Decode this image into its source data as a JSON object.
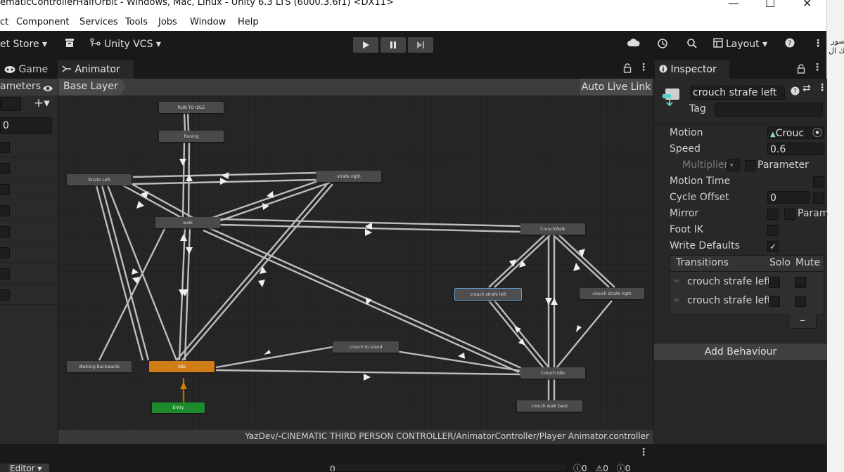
{
  "window": {
    "title": "ematicControllerHalfOrbit - Windows, Mac, Linux - Unity 6.3 LTS (6000.3.6f1) <DX11>",
    "minimize": "—",
    "maximize": "☐",
    "close": "✕"
  },
  "menu": [
    "ct",
    "Component",
    "Services",
    "Tools",
    "Jobs",
    "Window",
    "Help"
  ],
  "side_text": "سور\nك ال",
  "toolbar": {
    "asset_store": "et Store ▾",
    "unity_vcs": "Unity VCS ▾",
    "layout": "Layout ▾"
  },
  "tabs": {
    "game": "Game",
    "animator": "Animator",
    "inspector": "Inspector"
  },
  "animator": {
    "params_tab": "ameters",
    "param_value": "0",
    "layer": "Base Layer",
    "auto_live_link": "Auto Live Link",
    "footer_path": "YazDev/-CINEMATIC  THIRD PERSON CONTROLLER/AnimatorController/Player Animator.controller",
    "nodes": {
      "run_to_idle": "RUN TO IDLE",
      "runing": "Runing",
      "strafe_left": "Strafe Left",
      "strafe_right": "strafe rigth",
      "walk": "walk",
      "crouchwalk": "CrouchWalk",
      "crouch_strafe_left": "crouch strafe left",
      "crouch_strafe_right": "crouch strafe rigth",
      "crouch_to_stand": "crouch to stand",
      "walking_backwards": "Walking Backwards",
      "idle": "Idle",
      "crouch_idle": "Crouch Idle",
      "entry": "Entry",
      "crouch_walk_back": "crouch walk back"
    }
  },
  "inspector": {
    "state_name": "crouch strafe left",
    "tag_label": "Tag",
    "tag_value": "",
    "motion_label": "Motion",
    "motion_value": "Crouc",
    "speed_label": "Speed",
    "speed_value": "0.6",
    "multiplier_label": "Multiplier",
    "parameter_label": "Parameter",
    "motion_time_label": "Motion Time",
    "cycle_offset_label": "Cycle Offset",
    "cycle_offset_value": "0",
    "mirror_label": "Mirror",
    "param_label": "Param",
    "foot_ik_label": "Foot IK",
    "write_defaults_label": "Write Defaults",
    "write_defaults_checked": true,
    "transitions_label": "Transitions",
    "solo_label": "Solo",
    "mute_label": "Mute",
    "transitions": [
      "crouch strafe left",
      "crouch strafe left"
    ],
    "remove_button": "–",
    "add_behaviour": "Add Behaviour"
  },
  "bottom": {
    "editor_tab": "Editor ▾",
    "search_value": "0",
    "count_logs": "0",
    "count_warnings": "0",
    "count_errors": "0"
  },
  "colors": {
    "default_state": "#d07d17",
    "entry_state": "#1d8a2c",
    "selected_outline": "#5fa0d8",
    "arrow_color": "#cfcfcf"
  }
}
